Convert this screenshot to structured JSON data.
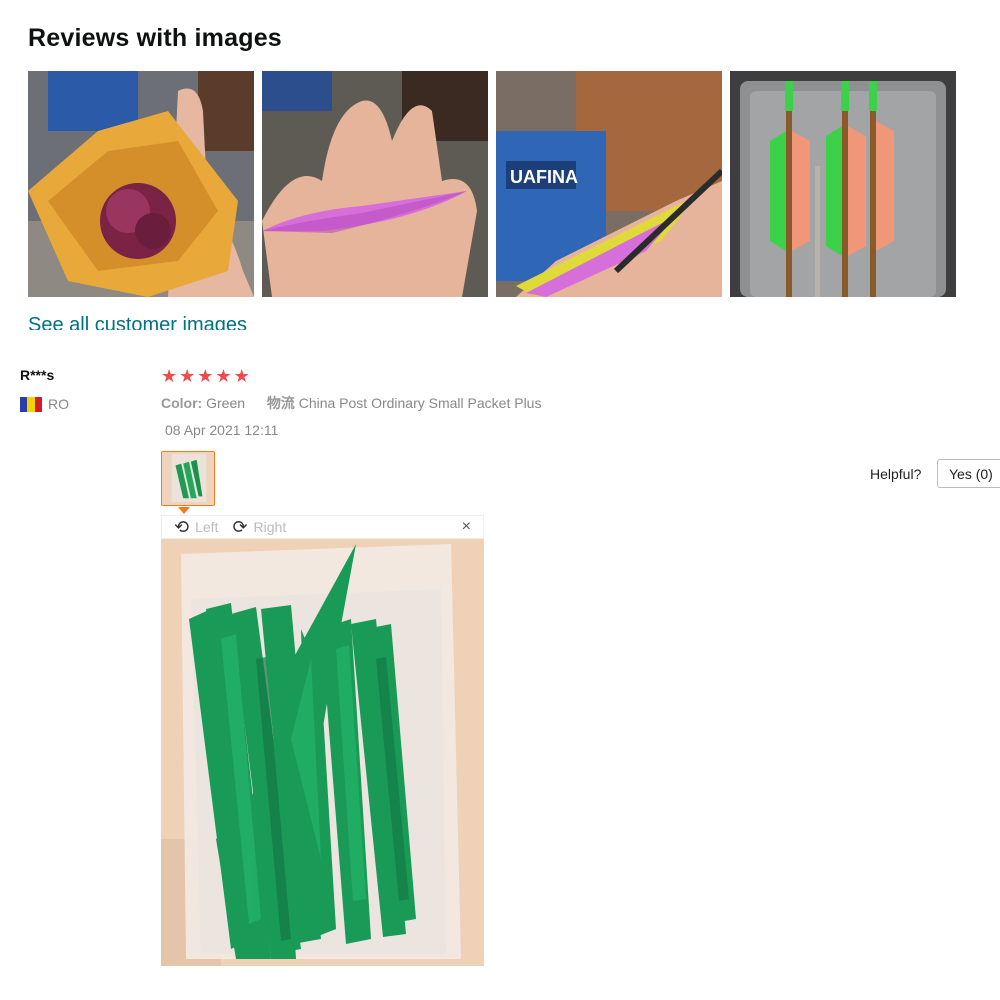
{
  "section": {
    "title": "Reviews with images",
    "see_all": "See all customer images"
  },
  "gallery": [
    {
      "name": "bag-of-purple-vanes"
    },
    {
      "name": "purple-vane-in-hand"
    },
    {
      "name": "arrow-fletching-closeup"
    },
    {
      "name": "arrows-in-case"
    }
  ],
  "review": {
    "reviewer": "R***s",
    "country": "RO",
    "flag_colors": [
      "#2b3ea8",
      "#f5d100",
      "#d11d2a"
    ],
    "rating": 5,
    "stars": [
      "★",
      "★",
      "★",
      "★",
      "★"
    ],
    "color_label": "Color:",
    "color_value": "Green",
    "logistics_label": "物流",
    "logistics_value": "China Post Ordinary Small Packet Plus",
    "date": "08 Apr 2021 12:11",
    "viewer": {
      "left_label": "Left",
      "right_label": "Right",
      "rotate_left_icon": "⟲",
      "rotate_right_icon": "⟳",
      "close_icon": "×"
    },
    "helpful_label": "Helpful?",
    "yes_label": "Yes (0)"
  },
  "colors": {
    "star": "#f04a4a",
    "link": "#007185",
    "thumb_border": "#f07b1e"
  }
}
